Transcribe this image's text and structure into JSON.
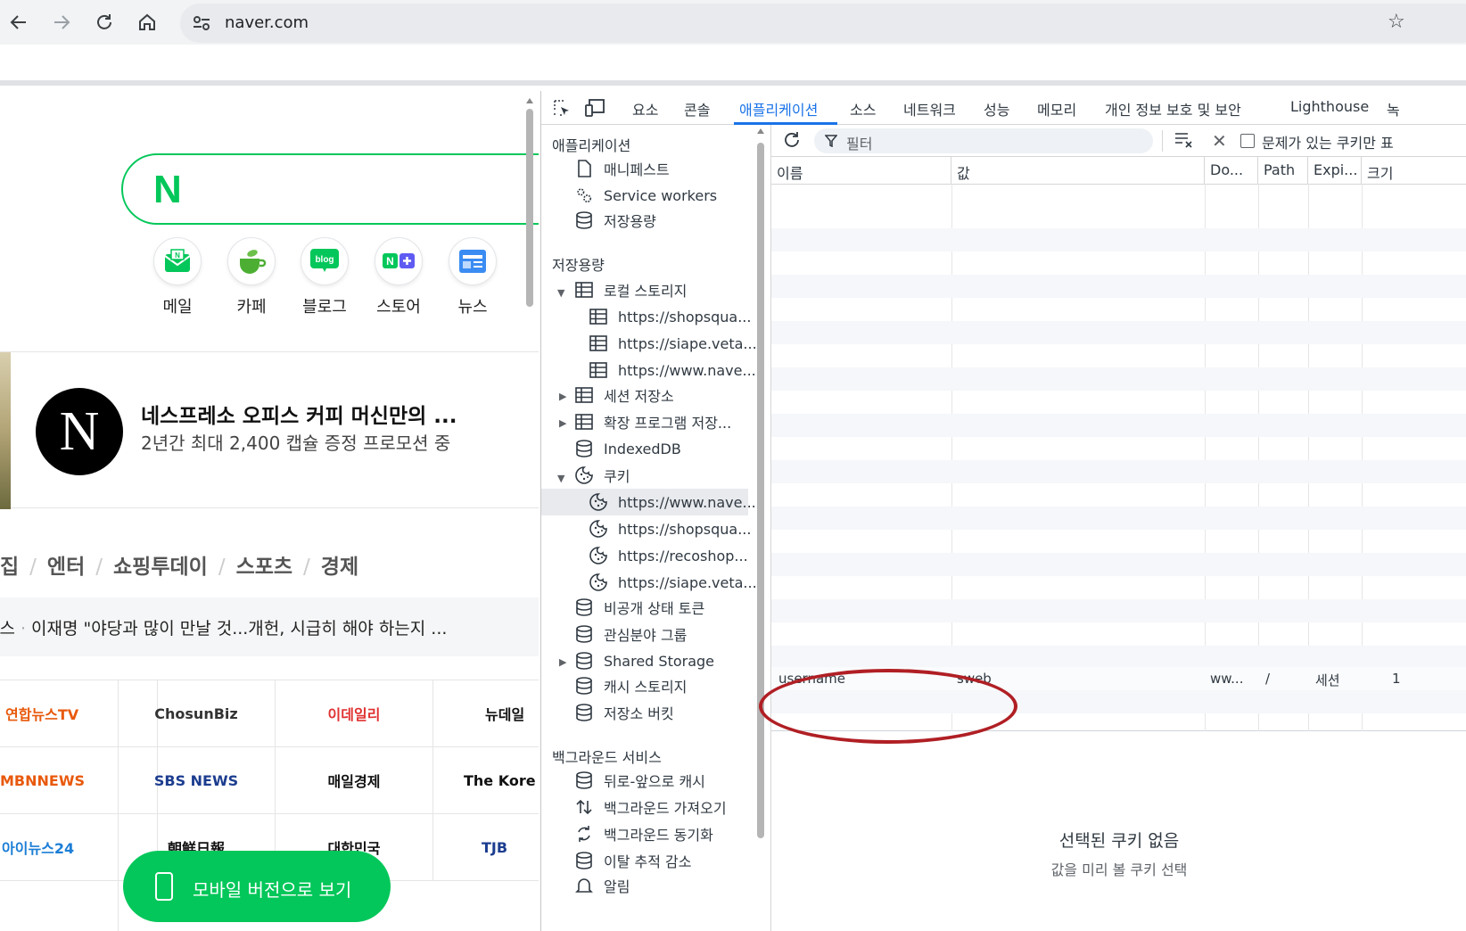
{
  "browser": {
    "url": "naver.com",
    "icons": [
      "back-icon",
      "forward-icon",
      "reload-icon",
      "home-icon",
      "site-settings-icon",
      "bookmark-star-icon"
    ]
  },
  "page": {
    "logo": "N",
    "services": [
      {
        "label": "메일",
        "icon": "mail-icon"
      },
      {
        "label": "카페",
        "icon": "cafe-icon"
      },
      {
        "label": "블로그",
        "icon": "blog-icon"
      },
      {
        "label": "스토어",
        "icon": "store-icon"
      },
      {
        "label": "뉴스",
        "icon": "news-icon"
      }
    ],
    "ad": {
      "title": "네스프레소 오피스 커피 머신만의 ...",
      "subtitle": "2년간 최대 2,400 캡슐 증정 프로모션 중",
      "logo": "N"
    },
    "tabs": [
      "집",
      "엔터",
      "쇼핑투데이",
      "스포츠",
      "경제"
    ],
    "headline": {
      "prefix": "뉴스",
      "text": "이재명 \"야당과 많이 만날 것...개헌, 시급히 해야 하는지 ..."
    },
    "press": [
      {
        "name": "연합뉴스TV",
        "color": "#e8590c"
      },
      {
        "name": "ChosunBiz",
        "color": "#333333"
      },
      {
        "name": "이데일리",
        "color": "#e03131"
      },
      {
        "name": "뉴데일",
        "color": "#111111"
      },
      {
        "name": "MBNNEWS",
        "color": "#e8590c"
      },
      {
        "name": "SBS NEWS",
        "color": "#1c3d8f"
      },
      {
        "name": "매일경제",
        "color": "#111111"
      },
      {
        "name": "The Kore",
        "color": "#111111"
      },
      {
        "name": "아이뉴스24",
        "color": "#1c7ed6"
      },
      {
        "name": "朝鮮日報",
        "color": "#111111"
      },
      {
        "name": "대한민국",
        "color": "#111111"
      },
      {
        "name": "TJB",
        "color": "#1c3d8f"
      }
    ],
    "mobile_button": "모바일 버전으로 보기"
  },
  "devtools": {
    "tabs": [
      "요소",
      "콘솔",
      "애플리케이션",
      "소스",
      "네트워크",
      "성능",
      "메모리",
      "개인 정보 보호 및 보안",
      "Lighthouse",
      "녹"
    ],
    "active_tab": "애플리케이션",
    "tree": {
      "sections": [
        {
          "title": "애플리케이션",
          "items": [
            {
              "label": "매니페스트",
              "icon": "file-icon"
            },
            {
              "label": "Service workers",
              "icon": "gears-icon"
            },
            {
              "label": "저장용량",
              "icon": "database-icon"
            }
          ]
        },
        {
          "title": "저장용량",
          "items": [
            {
              "label": "로컬 스토리지",
              "icon": "table-icon",
              "expanded": true
            },
            {
              "label": "https://shopsqua...",
              "icon": "table-icon",
              "child": true
            },
            {
              "label": "https://siape.veta...",
              "icon": "table-icon",
              "child": true
            },
            {
              "label": "https://www.nave...",
              "icon": "table-icon",
              "child": true
            },
            {
              "label": "세션 저장소",
              "icon": "table-icon",
              "expanded": false
            },
            {
              "label": "확장 프로그램 저장...",
              "icon": "table-icon",
              "expanded": false
            },
            {
              "label": "IndexedDB",
              "icon": "database-icon"
            },
            {
              "label": "쿠키",
              "icon": "cookie-icon",
              "expanded": true
            },
            {
              "label": "https://www.nave...",
              "icon": "cookie-icon",
              "child": true,
              "selected": true
            },
            {
              "label": "https://shopsqua...",
              "icon": "cookie-icon",
              "child": true
            },
            {
              "label": "https://recoshop...",
              "icon": "cookie-icon",
              "child": true
            },
            {
              "label": "https://siape.veta...",
              "icon": "cookie-icon",
              "child": true
            },
            {
              "label": "비공개 상태 토큰",
              "icon": "database-icon"
            },
            {
              "label": "관심분야 그룹",
              "icon": "database-icon"
            },
            {
              "label": "Shared Storage",
              "icon": "database-icon",
              "expanded": false
            },
            {
              "label": "캐시 스토리지",
              "icon": "database-icon"
            },
            {
              "label": "저장소 버킷",
              "icon": "database-icon"
            }
          ]
        },
        {
          "title": "백그라운드 서비스",
          "items": [
            {
              "label": "뒤로-앞으로 캐시",
              "icon": "database-icon"
            },
            {
              "label": "백그라운드 가져오기",
              "icon": "fetch-arrows-icon"
            },
            {
              "label": "백그라운드 동기화",
              "icon": "sync-icon"
            },
            {
              "label": "이탈 추적 감소",
              "icon": "database-icon"
            },
            {
              "label": "알림",
              "icon": "bell-icon"
            }
          ]
        }
      ]
    },
    "cookies": {
      "filter_placeholder": "필터",
      "only_issues_label": "문제가 있는 쿠키만 표",
      "columns": [
        "이름",
        "값",
        "Do...",
        "Path",
        "Expi...",
        "크기"
      ],
      "rows": [
        {
          "name": "username",
          "value": "sweb",
          "domain": "ww...",
          "path": "/",
          "expires": "세션",
          "size": "1"
        }
      ],
      "empty_title": "선택된 쿠키 없음",
      "empty_subtitle": "값을 미리 볼 쿠키 선택",
      "highlight_color": "#b01f24"
    }
  }
}
